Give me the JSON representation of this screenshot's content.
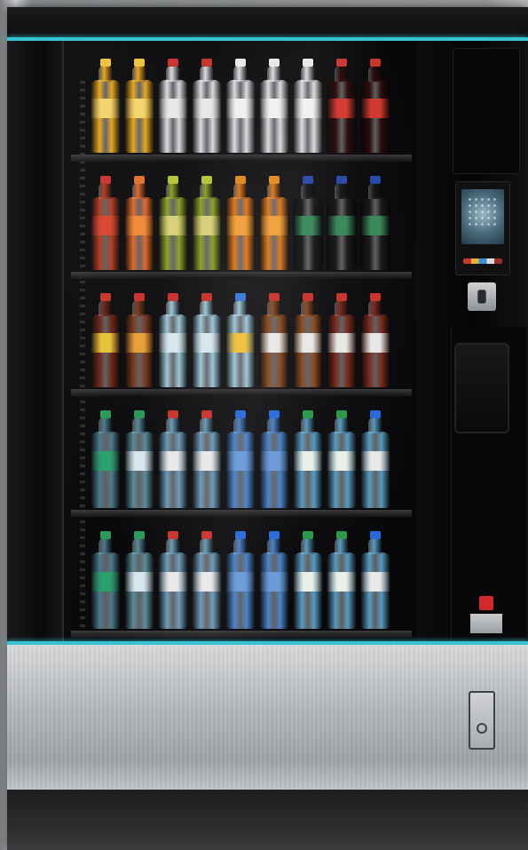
{
  "scene": {
    "subject": "vending-machine",
    "accent_color": "#39c2d6",
    "cabinet_color": "#0c0c0d",
    "base_color": "#b4b7ba"
  },
  "icons": {
    "card_reader": "touchscreen-icon",
    "coin_slot": "coin-slot-icon",
    "lock": "lock-icon",
    "logo": "brand-logo-icon"
  }
}
